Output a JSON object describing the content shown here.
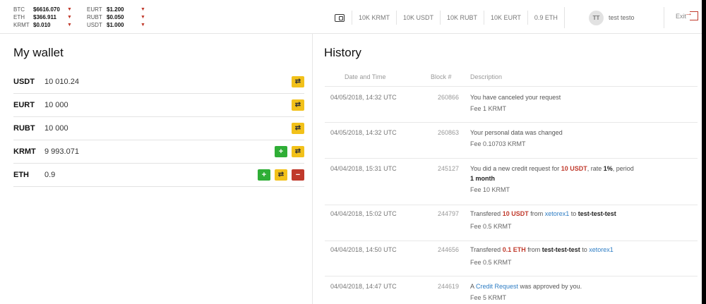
{
  "ticker": {
    "left": [
      {
        "symbol": "BTC",
        "price": "$6616.070"
      },
      {
        "symbol": "ETH",
        "price": "$366.911"
      },
      {
        "symbol": "KRMT",
        "price": "$0.010"
      }
    ],
    "right": [
      {
        "symbol": "EURT",
        "price": "$1.200"
      },
      {
        "symbol": "RUBT",
        "price": "$0.050"
      },
      {
        "symbol": "USDT",
        "price": "$1.000"
      }
    ]
  },
  "balances": [
    "10K KRMT",
    "10K USDT",
    "10K RUBT",
    "10K EURT",
    "0.9 ETH"
  ],
  "user": {
    "initials": "TT",
    "name": "test testo"
  },
  "exit_label": "Exit",
  "wallet": {
    "title": "My wallet",
    "rows": [
      {
        "currency": "USDT",
        "amount": "10 010.24"
      },
      {
        "currency": "EURT",
        "amount": "10 000"
      },
      {
        "currency": "RUBT",
        "amount": "10 000"
      },
      {
        "currency": "KRMT",
        "amount": "9 993.071"
      },
      {
        "currency": "ETH",
        "amount": "0.9"
      }
    ]
  },
  "history": {
    "title": "History",
    "columns": {
      "date": "Date and Time",
      "block": "Block #",
      "description": "Description"
    },
    "rows": [
      {
        "date": "04/05/2018, 14:32 UTC",
        "block": "260866",
        "fee": "Fee 1 KRMT",
        "d": {
          "text": "You have canceled your request"
        }
      },
      {
        "date": "04/05/2018, 14:32 UTC",
        "block": "260863",
        "fee": "Fee 0.10703 KRMT",
        "d": {
          "text": "Your personal data was changed"
        }
      },
      {
        "date": "04/04/2018, 15:31 UTC",
        "block": "245127",
        "fee": "Fee 10 KRMT",
        "d": {
          "p1": "You did a new credit request for ",
          "amount": "10 USDT",
          "p2": ", rate ",
          "rate": "1%",
          "p3": ", period",
          "period": "1 month"
        }
      },
      {
        "date": "04/04/2018, 15:02 UTC",
        "block": "244797",
        "fee": "Fee 0.5 KRMT",
        "d": {
          "p1": "Transfered ",
          "amount": "10 USDT",
          "p2": " from ",
          "from": "xetorex1",
          "p3": " to ",
          "to": "test-test-test"
        }
      },
      {
        "date": "04/04/2018, 14:50 UTC",
        "block": "244656",
        "fee": "Fee 0.5 KRMT",
        "d": {
          "p1": "Transfered ",
          "amount": "0.1 ETH",
          "p2": " from ",
          "from": "test-test-test",
          "p3": " to ",
          "to": "xetorex1"
        }
      },
      {
        "date": "04/04/2018, 14:47 UTC",
        "block": "244619",
        "fee": "Fee 5 KRMT",
        "d": {
          "p1": "A ",
          "link": "Credit Request",
          "p2": " was approved by you."
        }
      }
    ]
  },
  "colors": {
    "accent_red": "#c0392b",
    "add_green": "#2fae36",
    "exchange_yellow": "#f2c11a",
    "link_blue": "#2e7dc4"
  },
  "icons": {
    "add": "plus-icon",
    "exchange": "exchange-arrows-icon",
    "remove": "minus-icon",
    "wallet": "wallet-icon",
    "exit": "exit-icon",
    "dropdown": "caret-down-icon"
  }
}
